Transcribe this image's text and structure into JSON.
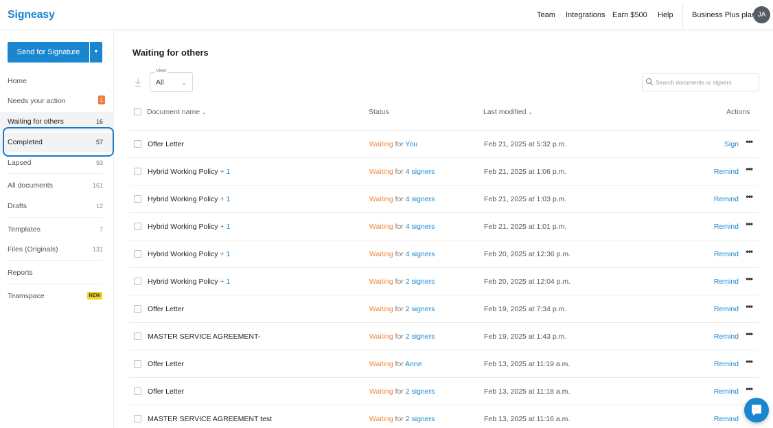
{
  "app": {
    "logo": "Signeasy",
    "nav": [
      "Team",
      "Integrations",
      "Earn $500",
      "Help"
    ],
    "plan": "Business Plus plan",
    "avatar_initials": "JA"
  },
  "sidebar": {
    "send_button": "Send for Signature",
    "items": [
      {
        "label": "Home",
        "count": ""
      },
      {
        "label": "Needs your action",
        "count": "1"
      },
      {
        "label": "Waiting for others",
        "count": "16"
      },
      {
        "label": "Completed",
        "count": "57"
      },
      {
        "label": "Lapsed",
        "count": "93"
      },
      {
        "label": "All documents",
        "count": "161"
      },
      {
        "label": "Drafts",
        "count": "12"
      },
      {
        "label": "Templates",
        "count": "7"
      },
      {
        "label": "Files (Originals)",
        "count": "131"
      },
      {
        "label": "Reports",
        "count": ""
      },
      {
        "label": "Teamspace",
        "count": "NEW"
      }
    ]
  },
  "main": {
    "title": "Waiting for others",
    "view": {
      "label": "View",
      "value": "All"
    },
    "search_placeholder": "Search documents or signers",
    "columns": {
      "name": "Document name",
      "status": "Status",
      "modified": "Last modified",
      "actions": "Actions"
    },
    "rows": [
      {
        "name": "Offer Letter",
        "extra": "",
        "status": "Waiting",
        "for": "for",
        "who": "You",
        "date": "Feb 21, 2025 at 5:32 p.m.",
        "action": "Sign"
      },
      {
        "name": "Hybrid Working Policy",
        "extra": "+ 1",
        "status": "Waiting",
        "for": "for",
        "who": "4 signers",
        "date": "Feb 21, 2025 at 1:06 p.m.",
        "action": "Remind"
      },
      {
        "name": "Hybrid Working Policy",
        "extra": "+ 1",
        "status": "Waiting",
        "for": "for",
        "who": "4 signers",
        "date": "Feb 21, 2025 at 1:03 p.m.",
        "action": "Remind"
      },
      {
        "name": "Hybrid Working Policy",
        "extra": "+ 1",
        "status": "Waiting",
        "for": "for",
        "who": "4 signers",
        "date": "Feb 21, 2025 at 1:01 p.m.",
        "action": "Remind"
      },
      {
        "name": "Hybrid Working Policy",
        "extra": "+ 1",
        "status": "Waiting",
        "for": "for",
        "who": "4 signers",
        "date": "Feb 20, 2025 at 12:36 p.m.",
        "action": "Remind"
      },
      {
        "name": "Hybrid Working Policy",
        "extra": "+ 1",
        "status": "Waiting",
        "for": "for",
        "who": "2 signers",
        "date": "Feb 20, 2025 at 12:04 p.m.",
        "action": "Remind"
      },
      {
        "name": "Offer Letter",
        "extra": "",
        "status": "Waiting",
        "for": "for",
        "who": "2 signers",
        "date": "Feb 19, 2025 at 7:34 p.m.",
        "action": "Remind"
      },
      {
        "name": "MASTER SERVICE AGREEMENT-",
        "extra": "",
        "status": "Waiting",
        "for": "for",
        "who": "2 signers",
        "date": "Feb 19, 2025 at 1:43 p.m.",
        "action": "Remind"
      },
      {
        "name": "Offer Letter",
        "extra": "",
        "status": "Waiting",
        "for": "for",
        "who": "Anne",
        "date": "Feb 13, 2025 at 11:19 a.m.",
        "action": "Remind"
      },
      {
        "name": "Offer Letter",
        "extra": "",
        "status": "Waiting",
        "for": "for",
        "who": "2 signers",
        "date": "Feb 13, 2025 at 11:18 a.m.",
        "action": "Remind"
      },
      {
        "name": "MASTER SERVICE AGREEMENT test",
        "extra": "",
        "status": "Waiting",
        "for": "for",
        "who": "2 signers",
        "date": "Feb 13, 2025 at 11:16 a.m.",
        "action": "Remind"
      }
    ]
  },
  "colors": {
    "accent": "#1a86d0",
    "waiting": "#f0843c",
    "focus_ring": "#1678c9",
    "badge_new": "#f6d21f"
  }
}
